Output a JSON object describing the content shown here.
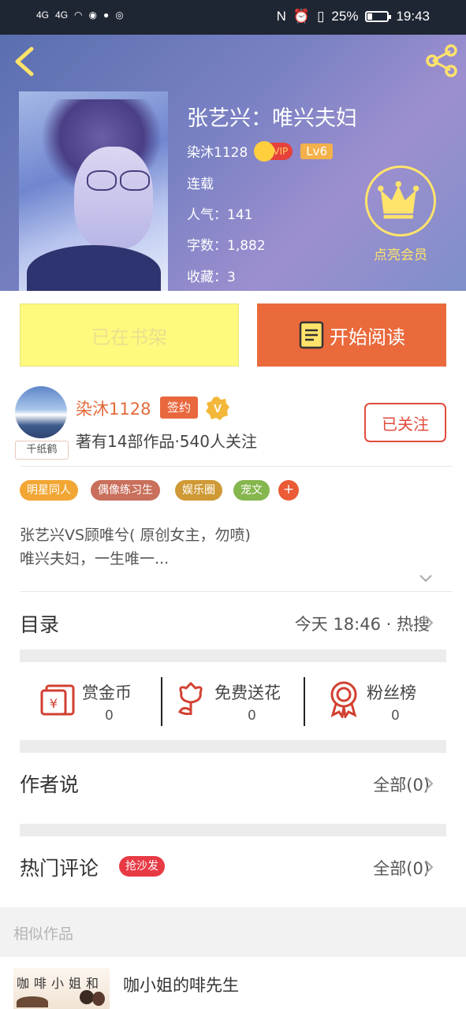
{
  "status_bar": {
    "network": [
      "4G",
      "4G"
    ],
    "battery": "25%",
    "time": "19:43"
  },
  "book": {
    "title": "张艺兴：唯兴夫妇",
    "author": "染沐1128",
    "vip_label": "VIP",
    "level": "Lv6",
    "status": "连载",
    "popularity_label": "人气：",
    "popularity": "141",
    "word_count_label": "字数：",
    "word_count": "1,882",
    "favorites_label": "收藏：",
    "favorites": "3",
    "vip_cta": "点亮会员"
  },
  "actions": {
    "shelf": "已在书架",
    "read": "开始阅读"
  },
  "author": {
    "name": "染沐1128",
    "signed": "签约",
    "verified": "V",
    "stats": "著有14部作品·540人关注",
    "follow": "已关注",
    "avatar_tag": "千纸鹤"
  },
  "tags": [
    {
      "label": "明星同人",
      "color": "#f2a634"
    },
    {
      "label": "偶像练习生",
      "color": "#c9705c"
    },
    {
      "label": "娱乐圈",
      "color": "#cf9a35"
    },
    {
      "label": "宠文",
      "color": "#86b64e"
    }
  ],
  "tag_more": "+",
  "description": {
    "line1": "张艺兴VS顾唯兮( 原创女主，勿喷)",
    "line2": "唯兴夫妇，一生唯一..."
  },
  "catalog": {
    "title": "目录",
    "update": "今天 18:46 · 热搜"
  },
  "rewards": [
    {
      "label": "赏金币",
      "value": "0",
      "icon": "coin-envelope-icon"
    },
    {
      "label": "免费送花",
      "value": "0",
      "icon": "flower-icon"
    },
    {
      "label": "粉丝榜",
      "value": "0",
      "icon": "medal-icon"
    }
  ],
  "author_says": {
    "title": "作者说",
    "all": "全部(0)"
  },
  "hot_comments": {
    "title": "热门评论",
    "badge": "抢沙发",
    "all": "全部(0)"
  },
  "similar": {
    "header": "相似作品",
    "items": [
      {
        "title": "咖小姐的啡先生",
        "cover_text": "咖啡小姐和"
      }
    ]
  },
  "colors": {
    "accent_orange": "#ea6a3c",
    "shelf_yellow": "#fff97e",
    "follow_red": "#e24b3c",
    "vip_gold": "#ffe36b"
  }
}
